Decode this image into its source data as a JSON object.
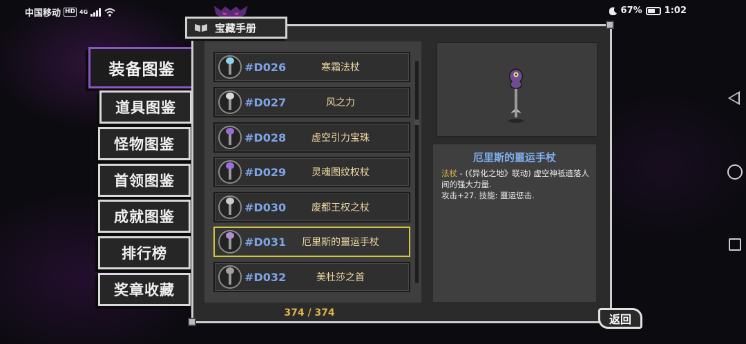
{
  "status_bar": {
    "carrier": "中国移动",
    "hd": "HD",
    "network": "4G",
    "battery": "67%",
    "time": "1:02"
  },
  "header": {
    "title": "宝藏手册"
  },
  "tabs": [
    {
      "label": "装备图鉴",
      "active": true
    },
    {
      "label": "道具图鉴"
    },
    {
      "label": "怪物图鉴"
    },
    {
      "label": "首领图鉴"
    },
    {
      "label": "成就图鉴"
    },
    {
      "label": "排行榜"
    },
    {
      "label": "奖章收藏"
    }
  ],
  "list": {
    "items": [
      {
        "code": "#D026",
        "name": "寒霜法杖",
        "color": "#8fd1e6"
      },
      {
        "code": "#D027",
        "name": "风之力",
        "color": "#d9d9d9"
      },
      {
        "code": "#D028",
        "name": "虚空引力宝珠",
        "color": "#9a6ad6"
      },
      {
        "code": "#D029",
        "name": "灵魂图纹权杖",
        "color": "#a06de0"
      },
      {
        "code": "#D030",
        "name": "废都王权之杖",
        "color": "#cccccc"
      },
      {
        "code": "#D031",
        "name": "厄里斯的噩运手杖",
        "color": "#b58ad6",
        "selected": true
      },
      {
        "code": "#D032",
        "name": "美杜莎之首",
        "color": "#a0a0a0"
      }
    ],
    "counter": "374 / 374"
  },
  "detail": {
    "title": "厄里斯的噩运手杖",
    "category": "法杖",
    "description": " - (《异化之地》联动) 虚空神祗遗落人间的强大力量.",
    "stats": "攻击+27. 技能: 噩运惩击."
  },
  "back_button": {
    "label": "返回"
  },
  "colors": {
    "accent_purple": "#8d55c8",
    "selected_border": "#d6c63e",
    "code_blue": "#7fa3e6",
    "name_gold": "#efd9a3"
  }
}
